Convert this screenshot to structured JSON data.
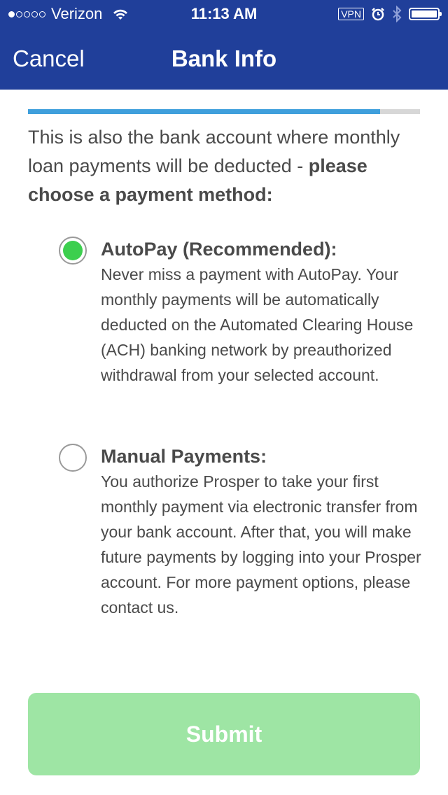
{
  "status_bar": {
    "signal_dots": [
      true,
      false,
      false,
      false,
      false
    ],
    "carrier": "Verizon",
    "time": "11:13 AM",
    "vpn": "VPN",
    "icons": [
      "wifi-icon",
      "alarm-icon",
      "bluetooth-icon",
      "battery-icon"
    ]
  },
  "nav": {
    "cancel_label": "Cancel",
    "title": "Bank Info"
  },
  "progress": {
    "fraction": 0.898
  },
  "intro": {
    "text": "This is also the bank account where monthly loan payments will be deducted - ",
    "bold": "please choose a payment method:"
  },
  "options": [
    {
      "title": "AutoPay (Recommended):",
      "description": "Never miss a payment with AutoPay. Your monthly payments will be automatically deducted on the Automated Clearing House (ACH) banking network by preauthorized withdrawal from your selected account.",
      "selected": true
    },
    {
      "title": "Manual Payments:",
      "description": "You authorize Prosper to take your first monthly payment via electronic transfer from your bank account. After that, you will make future payments by logging into your Prosper account. For more payment options, please contact us.",
      "selected": false
    }
  ],
  "submit_label": "Submit",
  "colors": {
    "nav_background": "#203f9a",
    "progress_fill": "#3f9fdc",
    "radio_selected": "#3ccf4e",
    "submit_background": "#9ee5a4"
  }
}
